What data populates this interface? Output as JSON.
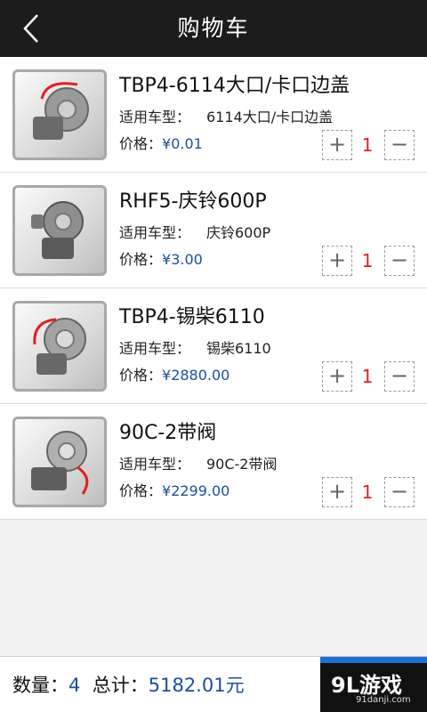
{
  "header": {
    "title": "购物车",
    "back_icon": "chevron-left-icon"
  },
  "labels": {
    "model": "适用车型：",
    "price": "价格："
  },
  "items": [
    {
      "name": "TBP4-6114大口/卡口边盖",
      "model": "6114大口/卡口边盖",
      "price": "¥0.01",
      "qty": "1",
      "plus": "+",
      "minus": "−"
    },
    {
      "name": "RHF5-庆铃600P",
      "model": "庆铃600P",
      "price": "¥3.00",
      "qty": "1",
      "plus": "+",
      "minus": "−"
    },
    {
      "name": "TBP4-锡柴6110",
      "model": "锡柴6110",
      "price": "¥2880.00",
      "qty": "1",
      "plus": "+",
      "minus": "−"
    },
    {
      "name": "90C-2带阀",
      "model": "90C-2带阀",
      "price": "¥2299.00",
      "qty": "1",
      "plus": "+",
      "minus": "−"
    }
  ],
  "footer": {
    "count_label": "数量：",
    "count": "4",
    "total_label": "总计：",
    "total": "5182.01元",
    "watermark": "9L游戏",
    "watermark_url": "91danji.com"
  },
  "colors": {
    "accent": "#1a4f9c",
    "qty": "#e02020",
    "titlebar": "#1c1c1c"
  }
}
